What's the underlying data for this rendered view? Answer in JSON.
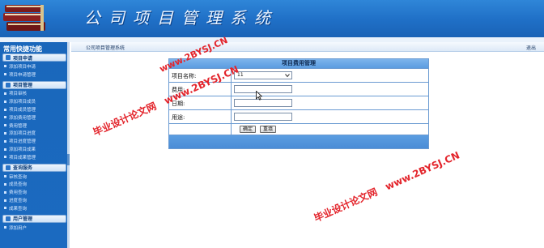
{
  "header": {
    "title": "公司项目管理系统"
  },
  "sidebar": {
    "title": "常用快捷功能",
    "groups": [
      {
        "label": "项目申请",
        "items": [
          "添加项目申请",
          "项目申请管理"
        ]
      },
      {
        "label": "项目管理",
        "items": [
          "项目审核",
          "添加项目成员",
          "项目成员管理",
          "添加费用管理",
          "费用管理",
          "添加项目进度",
          "项目进度管理",
          "添加项目成果",
          "项目成果管理"
        ]
      },
      {
        "label": "查询服务",
        "items": [
          "审核查询",
          "成员查询",
          "费用查询",
          "进度查询",
          "成果查询"
        ]
      },
      {
        "label": "用户管理",
        "items": [
          "添加用户"
        ]
      }
    ]
  },
  "main": {
    "breadcrumb": "公司项目管理系统",
    "logout_label": "退出",
    "panel": {
      "title": "项目费用管理",
      "fields": {
        "project_name_label": "项目名称:",
        "project_name_value": "11",
        "cost_label": "费用:",
        "date_label": "日期:",
        "purpose_label": "用途:"
      },
      "buttons": {
        "confirm": "确定",
        "reset": "重填"
      }
    }
  },
  "watermarks": [
    "毕业设计论文网",
    "www.2BYSJ.CN"
  ],
  "colors": {
    "header_blue": "#1f6fc6",
    "sidebar_blue": "#1b6ac0",
    "panel_border": "#6b9bd2",
    "watermark_red": "#e3242b"
  }
}
